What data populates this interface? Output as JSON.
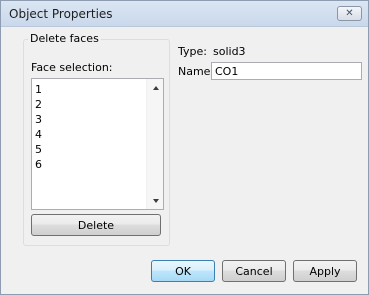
{
  "window": {
    "title": "Object Properties",
    "close_label": "✕"
  },
  "delete_faces": {
    "group_title": "Delete faces",
    "face_selection_label": "Face selection:",
    "faces": [
      "1",
      "2",
      "3",
      "4",
      "5",
      "6"
    ],
    "delete_label": "Delete"
  },
  "properties": {
    "type_label": "Type:",
    "type_value": "solid3",
    "name_label": "Name:",
    "name_value": "CO1"
  },
  "buttons": {
    "ok": "OK",
    "cancel": "Cancel",
    "apply": "Apply"
  }
}
